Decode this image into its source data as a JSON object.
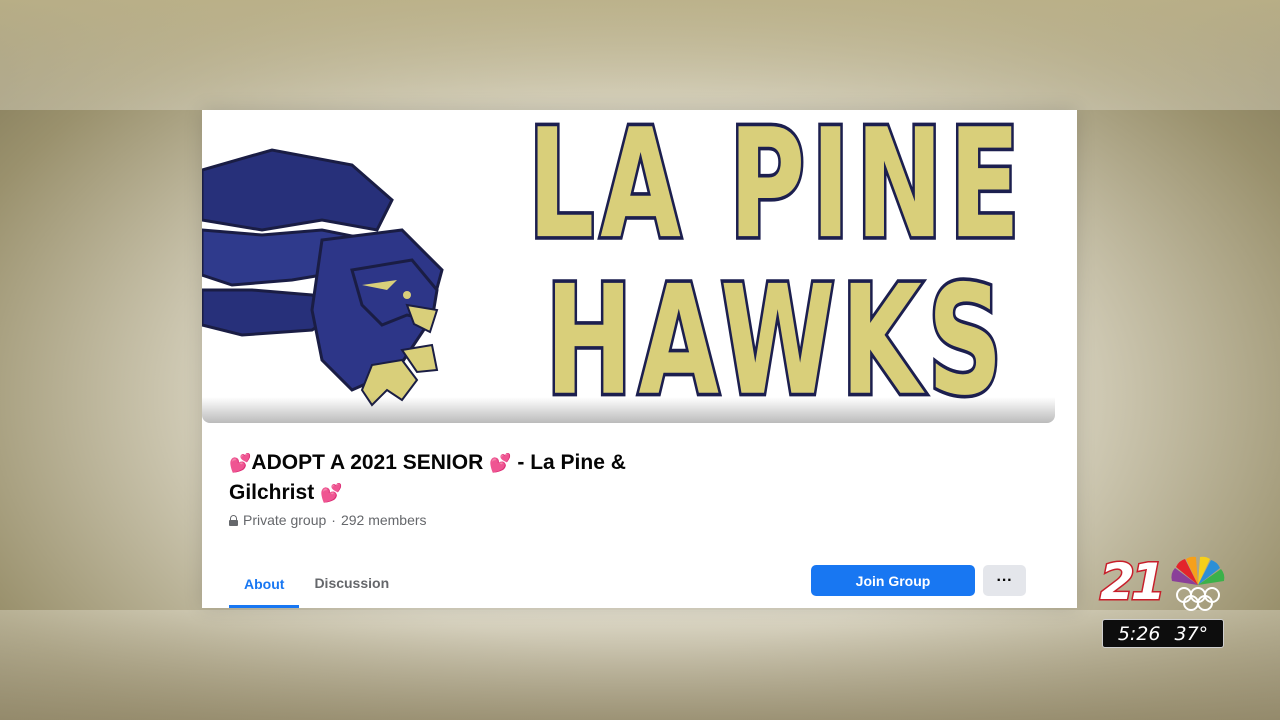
{
  "cover": {
    "line1": "LA PINE",
    "line2": "HAWKS"
  },
  "group": {
    "title_part1": "ADOPT A 2021 SENIOR",
    "title_part2": "- La Pine & Gilchrist",
    "heart": "💕",
    "privacy": "Private group",
    "separator": "·",
    "members": "292 members"
  },
  "tabs": [
    {
      "label": "About",
      "active": true
    },
    {
      "label": "Discussion",
      "active": false
    }
  ],
  "actions": {
    "join_label": "Join Group",
    "more_label": "···"
  },
  "overlay": {
    "channel": "21",
    "time": "5:26",
    "temperature": "37°"
  },
  "colors": {
    "accent": "#1877f2",
    "hawks_gold": "#d9cf7a",
    "hawks_navy": "#1c1f4f",
    "station_red": "#c81e2a"
  }
}
